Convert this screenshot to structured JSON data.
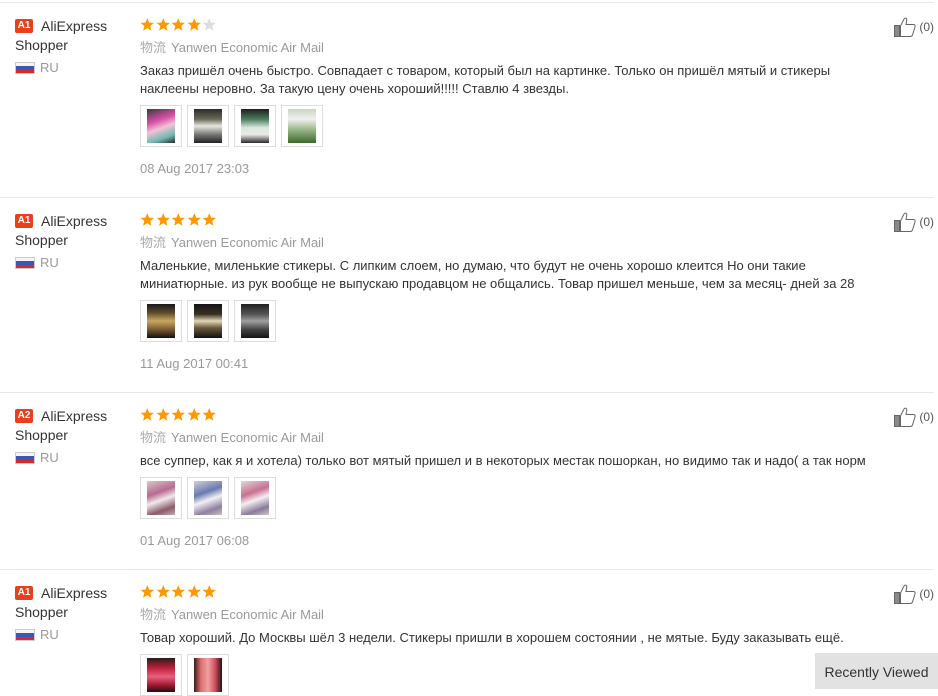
{
  "colors": {
    "star": "#ff9900",
    "star_empty": "#dddddd",
    "badge": "#e8401c"
  },
  "reviews": [
    {
      "badge": "A1",
      "user_line1": "AliExpress",
      "user_line2": "Shopper",
      "country": "RU",
      "rating": 4,
      "logistics_label": "物流",
      "logistics": "Yanwen Economic Air Mail",
      "text": "Заказ пришёл очень быстро. Совпадает с товаром, который был на картинке. Только он пришёл мятый и стикеры наклеены неровно. За такую цену очень хороший!!!!! Ставлю 4 звезды.",
      "photos": 4,
      "date": "08 Aug 2017 23:03",
      "helpful": "(0)"
    },
    {
      "badge": "A1",
      "user_line1": "AliExpress",
      "user_line2": "Shopper",
      "country": "RU",
      "rating": 5,
      "logistics_label": "物流",
      "logistics": "Yanwen Economic Air Mail",
      "text": "Маленькие, миленькие стикеры. С липким слоем, но думаю, что будут не очень хорошо клеится Но они такие миниатюрные. из рук вообще не выпускаю продавцом не общались. Товар пришел меньше, чем за месяц- дней за 28",
      "photos": 3,
      "date": "11 Aug 2017 00:41",
      "helpful": "(0)"
    },
    {
      "badge": "A2",
      "user_line1": "AliExpress",
      "user_line2": "Shopper",
      "country": "RU",
      "rating": 5,
      "logistics_label": "物流",
      "logistics": "Yanwen Economic Air Mail",
      "text": "все суппер, как я и хотела) только вот мятый пришел и в некоторых местак пошоркан, но видимо так и надо( а так норм",
      "photos": 3,
      "date": "01 Aug 2017 06:08",
      "helpful": "(0)"
    },
    {
      "badge": "A1",
      "user_line1": "AliExpress",
      "user_line2": "Shopper",
      "country": "RU",
      "rating": 5,
      "logistics_label": "物流",
      "logistics": "Yanwen Economic Air Mail",
      "text": "Товар хороший. До Москвы шёл 3 недели. Стикеры пришли в хорошем состоянии , не мятые. Буду заказывать ещё.",
      "photos": 2,
      "date": "",
      "helpful": "(0)"
    }
  ],
  "recently_viewed": "Recently Viewed"
}
